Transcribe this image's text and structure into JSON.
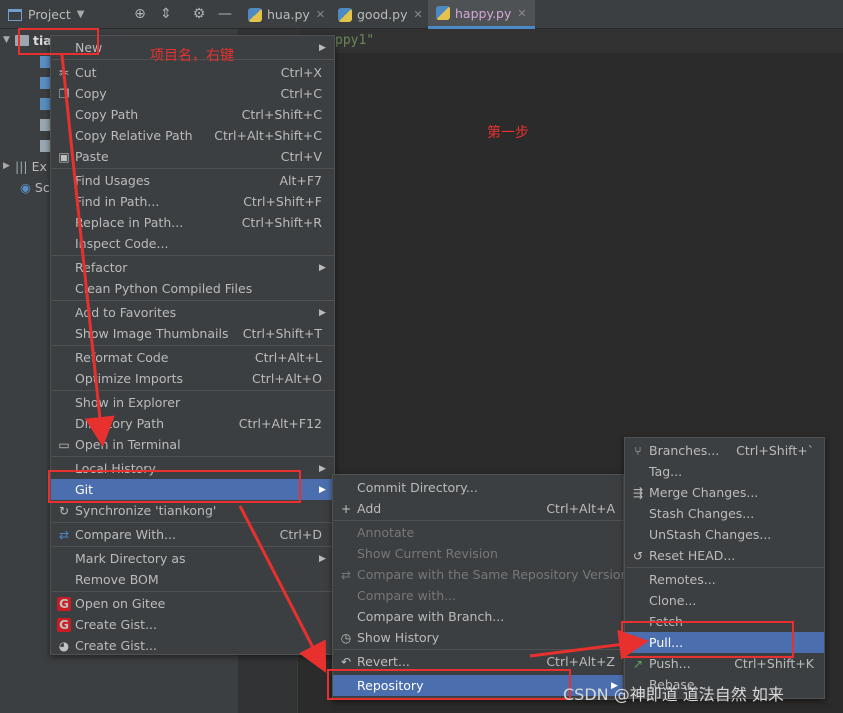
{
  "topbar": {
    "project_label": "Project",
    "tabs": [
      {
        "name": "hua.py"
      },
      {
        "name": "good.py"
      },
      {
        "name": "happy.py"
      }
    ]
  },
  "tree": {
    "root": "tiank",
    "ext_label": "Ex",
    "sc_label": "Sc"
  },
  "editor": {
    "line1": "ppy1\""
  },
  "context_menu": {
    "items": [
      {
        "label": "New",
        "shortcut": ""
      },
      {
        "label": "Cut",
        "shortcut": "Ctrl+X"
      },
      {
        "label": "Copy",
        "shortcut": "Ctrl+C"
      },
      {
        "label": "Copy Path",
        "shortcut": "Ctrl+Shift+C"
      },
      {
        "label": "Copy Relative Path",
        "shortcut": "Ctrl+Alt+Shift+C"
      },
      {
        "label": "Paste",
        "shortcut": "Ctrl+V"
      },
      {
        "label": "Find Usages",
        "shortcut": "Alt+F7"
      },
      {
        "label": "Find in Path...",
        "shortcut": "Ctrl+Shift+F"
      },
      {
        "label": "Replace in Path...",
        "shortcut": "Ctrl+Shift+R"
      },
      {
        "label": "Inspect Code...",
        "shortcut": ""
      },
      {
        "label": "Refactor",
        "shortcut": ""
      },
      {
        "label": "Clean Python Compiled Files",
        "shortcut": ""
      },
      {
        "label": "Add to Favorites",
        "shortcut": ""
      },
      {
        "label": "Show Image Thumbnails",
        "shortcut": "Ctrl+Shift+T"
      },
      {
        "label": "Reformat Code",
        "shortcut": "Ctrl+Alt+L"
      },
      {
        "label": "Optimize Imports",
        "shortcut": "Ctrl+Alt+O"
      },
      {
        "label": "Show in Explorer",
        "shortcut": ""
      },
      {
        "label": "Directory Path",
        "shortcut": "Ctrl+Alt+F12"
      },
      {
        "label": "Open in Terminal",
        "shortcut": ""
      },
      {
        "label": "Local History",
        "shortcut": ""
      },
      {
        "label": "Git",
        "shortcut": ""
      },
      {
        "label": "Synchronize 'tiankong'",
        "shortcut": ""
      },
      {
        "label": "Compare With...",
        "shortcut": "Ctrl+D"
      },
      {
        "label": "Mark Directory as",
        "shortcut": ""
      },
      {
        "label": "Remove BOM",
        "shortcut": ""
      },
      {
        "label": "Open on Gitee",
        "shortcut": ""
      },
      {
        "label": "Create Gist...",
        "shortcut": ""
      },
      {
        "label": "Create Gist...",
        "shortcut": ""
      }
    ]
  },
  "git_menu": {
    "items": [
      {
        "label": "Commit Directory...",
        "shortcut": ""
      },
      {
        "label": "Add",
        "shortcut": "Ctrl+Alt+A"
      },
      {
        "label": "Annotate",
        "shortcut": ""
      },
      {
        "label": "Show Current Revision",
        "shortcut": ""
      },
      {
        "label": "Compare with the Same Repository Version",
        "shortcut": ""
      },
      {
        "label": "Compare with...",
        "shortcut": ""
      },
      {
        "label": "Compare with Branch...",
        "shortcut": ""
      },
      {
        "label": "Show History",
        "shortcut": ""
      },
      {
        "label": "Revert...",
        "shortcut": "Ctrl+Alt+Z"
      },
      {
        "label": "Repository",
        "shortcut": ""
      }
    ]
  },
  "repo_menu": {
    "items": [
      {
        "label": "Branches...",
        "shortcut": "Ctrl+Shift+`"
      },
      {
        "label": "Tag...",
        "shortcut": ""
      },
      {
        "label": "Merge Changes...",
        "shortcut": ""
      },
      {
        "label": "Stash Changes...",
        "shortcut": ""
      },
      {
        "label": "UnStash Changes...",
        "shortcut": ""
      },
      {
        "label": "Reset HEAD...",
        "shortcut": ""
      },
      {
        "label": "Remotes...",
        "shortcut": ""
      },
      {
        "label": "Clone...",
        "shortcut": ""
      },
      {
        "label": "Fetch",
        "shortcut": ""
      },
      {
        "label": "Pull...",
        "shortcut": ""
      },
      {
        "label": "Push...",
        "shortcut": "Ctrl+Shift+K"
      },
      {
        "label": "Rebase...",
        "shortcut": ""
      }
    ]
  },
  "annotations": {
    "note1": "项目名，右键",
    "note2": "第一步"
  },
  "watermark": "CSDN @神即道 道法自然 如来",
  "colors": {
    "highlight": "#4b6eaf",
    "annotation": "#e8312f",
    "menu_bg": "#3c3f41"
  }
}
